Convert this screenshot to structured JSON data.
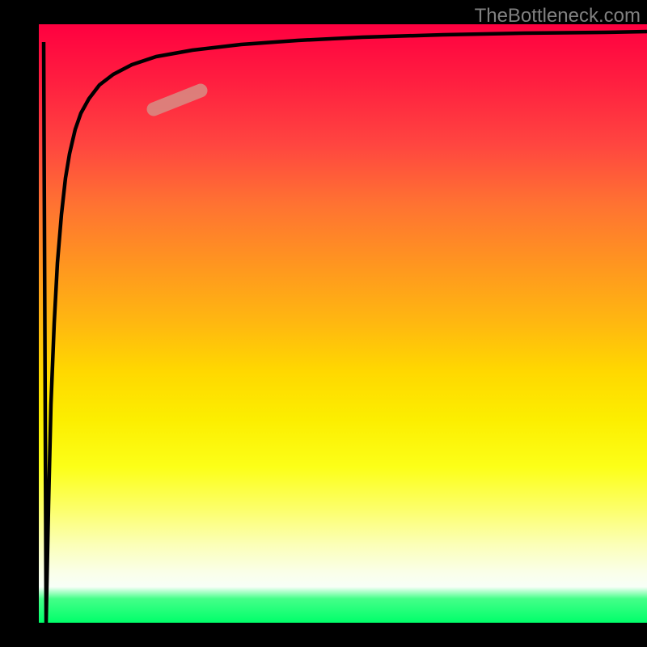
{
  "watermark": "TheBottleneck.com",
  "colors": {
    "background": "#000000",
    "curve": "#000000",
    "highlight": "#d98a83"
  },
  "chart_data": {
    "type": "line",
    "title": "",
    "xlabel": "",
    "ylabel": "",
    "xlim": [
      0,
      100
    ],
    "ylim": [
      0,
      100
    ],
    "x": [
      0.0,
      0.5,
      1.0,
      1.5,
      2.0,
      2.5,
      3.0,
      3.5,
      4.0,
      4.5,
      5.0,
      6.0,
      7.0,
      8.0,
      10.0,
      12.0,
      15.0,
      20.0,
      25.0,
      30.0,
      40.0,
      50.0,
      60.0,
      70.0,
      80.0,
      90.0,
      100.0
    ],
    "values": [
      97.0,
      0.0,
      18.0,
      33.0,
      45.0,
      55.0,
      62.0,
      68.0,
      72.5,
      76.0,
      79.0,
      83.0,
      85.5,
      87.5,
      90.0,
      91.5,
      93.0,
      94.5,
      95.5,
      96.0,
      96.8,
      97.2,
      97.6,
      97.9,
      98.1,
      98.3,
      98.5
    ],
    "highlight_segment": {
      "x_start": 19,
      "x_end": 26,
      "y_start": 85,
      "y_end": 88
    },
    "gradient_stops": [
      {
        "pos": 0,
        "color": "#ff0040"
      },
      {
        "pos": 50,
        "color": "#ffd800"
      },
      {
        "pos": 80,
        "color": "#fcff6a"
      },
      {
        "pos": 100,
        "color": "#00ff6a"
      }
    ]
  }
}
